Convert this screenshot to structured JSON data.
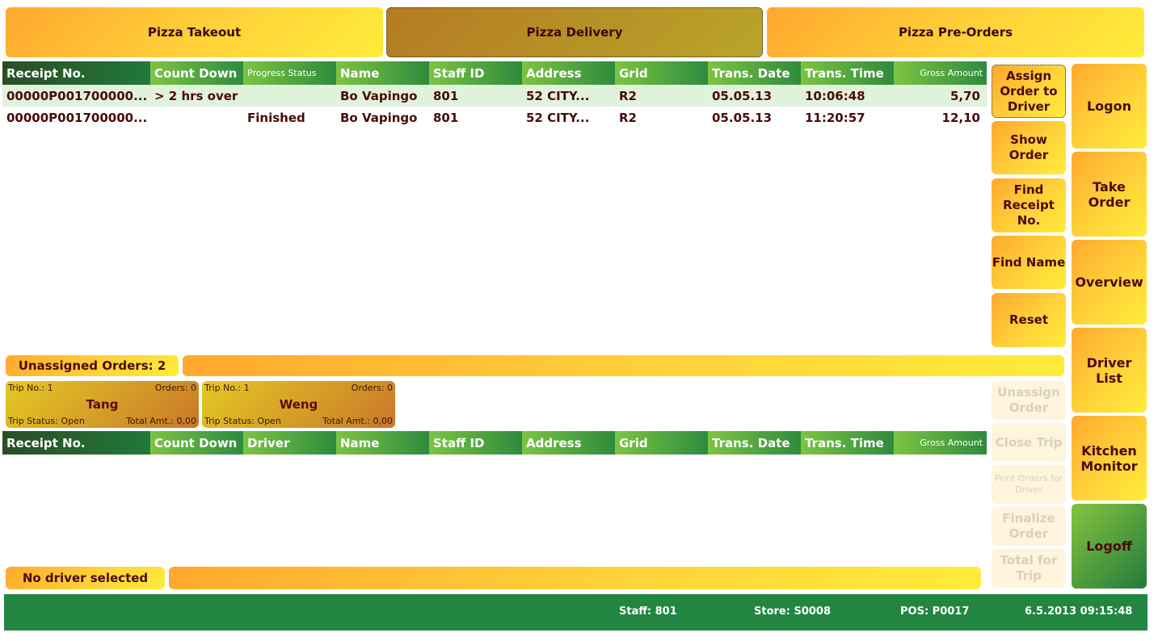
{
  "tabs": [
    "Pizza Takeout",
    "Pizza Delivery",
    "Pizza Pre-Orders"
  ],
  "orders_table": {
    "headers": [
      "Receipt No.",
      "Count Down",
      "Progress Status",
      "Name",
      "Staff ID",
      "Address",
      "Grid",
      "Trans. Date",
      "Trans. Time",
      "Gross Amount"
    ],
    "rows": [
      [
        "00000P001700000...",
        "> 2 hrs over",
        "",
        "Bo Vapingo",
        "801",
        "52 CITY...",
        "R2",
        "05.05.13",
        "10:06:48",
        "5,70"
      ],
      [
        "00000P001700000...",
        "",
        "Finished",
        "Bo Vapingo",
        "801",
        "52 CITY...",
        "R2",
        "05.05.13",
        "11:20:57",
        "12,10"
      ]
    ]
  },
  "unassigned_label": "Unassigned Orders: 2",
  "drivers": [
    {
      "trip": "Trip No.: 1",
      "orders": "Orders: 0",
      "name": "Tang",
      "status": "Trip Status: Open",
      "total": "Total Amt.: 0,00"
    },
    {
      "trip": "Trip No.: 1",
      "orders": "Orders: 0",
      "name": "Weng",
      "status": "Trip Status: Open",
      "total": "Total Amt.: 0,00"
    }
  ],
  "driver_table": {
    "headers": [
      "Receipt No.",
      "Count Down",
      "Driver",
      "Name",
      "Staff ID",
      "Address",
      "Grid",
      "Trans. Date",
      "Trans. Time",
      "Gross Amount"
    ]
  },
  "no_driver_label": "No driver selected",
  "actions": [
    "Assign Order to Driver",
    "Show Order",
    "Find Receipt No.",
    "Find Name",
    "Reset"
  ],
  "driver_actions": [
    "Unassign Order",
    "Close Trip",
    "Print Orders for Driver",
    "Finalize Order",
    "Total for Trip"
  ],
  "nav": [
    "Logon",
    "Take Order",
    "Overview",
    "Driver List",
    "Kitchen Monitor",
    "Logoff"
  ],
  "status": {
    "staff": "Staff: 801",
    "store": "Store: S0008",
    "pos": "POS: P0017",
    "datetime": "6.5.2013 09:15:48"
  }
}
